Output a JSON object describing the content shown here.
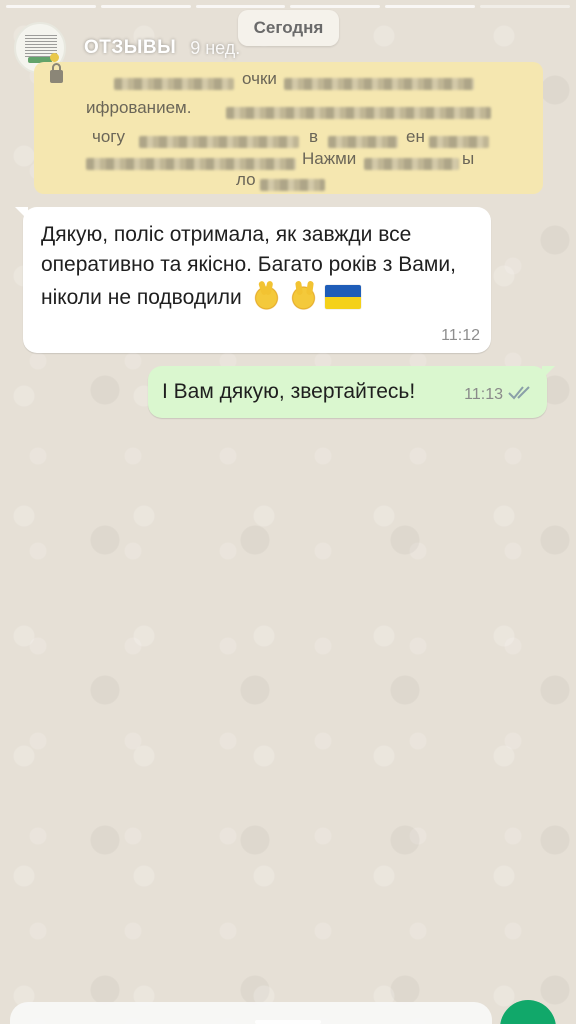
{
  "story": {
    "segments": 6
  },
  "channel": {
    "name": "ОТЗЫВЫ",
    "time": "9 нед."
  },
  "date_chip": "Сегодня",
  "encryption_notice": {
    "visible_fragments": [
      "очки",
      "ифрованием.",
      "чогу",
      "в",
      "ен",
      "Нажми",
      "ы",
      "ло"
    ]
  },
  "messages": [
    {
      "direction": "incoming",
      "text": "Дякую, поліс отримала, як завжди все оперативно та якісно. Багато років з Вами, ніколи не подводили",
      "emojis": [
        "victory-hand",
        "sign-of-horns",
        "ukraine-flag"
      ],
      "time": "11:12"
    },
    {
      "direction": "outgoing",
      "text": "І Вам дякую, звертайтесь!",
      "time": "11:13",
      "status": "read"
    }
  ],
  "colors": {
    "incoming_bubble": "#ffffff",
    "outgoing_bubble": "#daf7cf",
    "system_notice": "#f5e7b0",
    "send_button": "#11a86a",
    "read_ticks": "#8aa0a8"
  }
}
